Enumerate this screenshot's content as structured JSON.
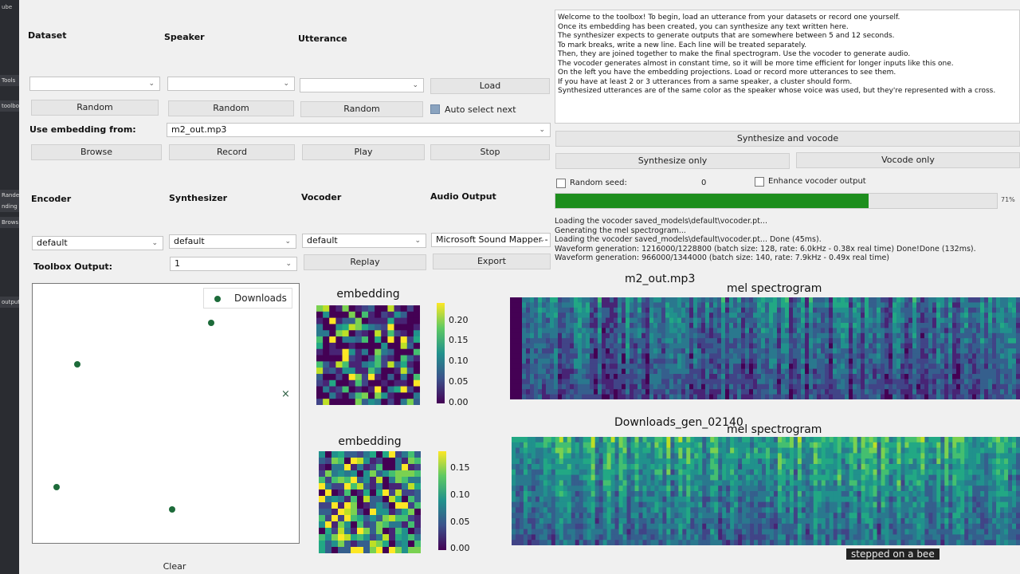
{
  "strip": {
    "top": "ube",
    "a": "Tools",
    "b": "toolbox",
    "c": "Rande",
    "d": "nding fro",
    "e": "Brows",
    "f": "output:"
  },
  "left": {
    "dataset_label": "Dataset",
    "speaker_label": "Speaker",
    "utterance_label": "Utterance",
    "load_button": "Load",
    "random_dataset": "Random",
    "random_speaker": "Random",
    "random_utterance": "Random",
    "auto_select_label": "Auto select next",
    "auto_select_checked": true,
    "use_embedding_label": "Use embedding from:",
    "embedding_source": "m2_out.mp3",
    "browse_button": "Browse",
    "record_button": "Record",
    "play_button": "Play",
    "stop_button": "Stop",
    "encoder_label": "Encoder",
    "synthesizer_label": "Synthesizer",
    "vocoder_label": "Vocoder",
    "audio_output_label": "Audio Output",
    "encoder_value": "default",
    "synthesizer_value": "default",
    "vocoder_value": "default",
    "audio_output_value": "Microsoft Sound Mapper - (",
    "toolbox_output_label": "Toolbox Output:",
    "toolbox_output_value": "1",
    "replay_button": "Replay",
    "export_button": "Export",
    "clear_button": "Clear"
  },
  "right": {
    "info_lines": [
      "Welcome to the toolbox! To begin, load an utterance from your datasets or record one yourself.",
      "Once its embedding has been created, you can synthesize any text written here.",
      "The synthesizer expects to generate outputs that are somewhere between 5 and 12 seconds.",
      "To mark breaks, write a new line. Each line will be treated separately.",
      "Then, they are joined together to make the final spectrogram. Use the vocoder to generate audio.",
      "The vocoder generates almost in constant time, so it will be more time efficient for longer inputs like this one.",
      "On the left you have the embedding projections. Load or record more utterances to see them.",
      "If you have at least 2 or 3 utterances from a same speaker, a cluster should form.",
      "Synthesized utterances are of the same color as the speaker whose voice was used, but they're represented with a cross."
    ],
    "synthesize_vocode_button": "Synthesize and vocode",
    "synthesize_only_button": "Synthesize only",
    "vocode_only_button": "Vocode only",
    "random_seed_label": "Random seed:",
    "random_seed_value": "0",
    "enhance_label": "Enhance vocoder output",
    "progress_percent": 71,
    "progress_text": "71%",
    "log_lines": [
      "Loading the vocoder saved_models\\default\\vocoder.pt...",
      "Generating the mel spectrogram...",
      "Loading the vocoder saved_models\\default\\vocoder.pt... Done (45ms).",
      "Waveform generation: 1216000/1228800 (batch size: 128, rate: 6.0kHz - 0.38x real time) Done!Done (132ms).",
      "Waveform generation: 966000/1344000 (batch size: 140, rate: 7.9kHz - 0.49x real time)"
    ]
  },
  "projection": {
    "legend_label": "Downloads",
    "cross_marker": "×"
  },
  "plots": {
    "top_name": "m2_out.mp3",
    "bottom_name": "Downloads_gen_02140",
    "embedding_title": "embedding",
    "spectrogram_title": "mel spectrogram",
    "top_colorbar_ticks": [
      "0.20",
      "0.15",
      "0.10",
      "0.05",
      "0.00"
    ],
    "bottom_colorbar_ticks": [
      "0.15",
      "0.10",
      "0.05",
      "0.00"
    ]
  },
  "caption": "stepped on a bee",
  "colors": {
    "viridis_dark": "#440154",
    "viridis_mid": "#21918c",
    "viridis_bright": "#fde725",
    "progress": "#1d8e1d"
  }
}
